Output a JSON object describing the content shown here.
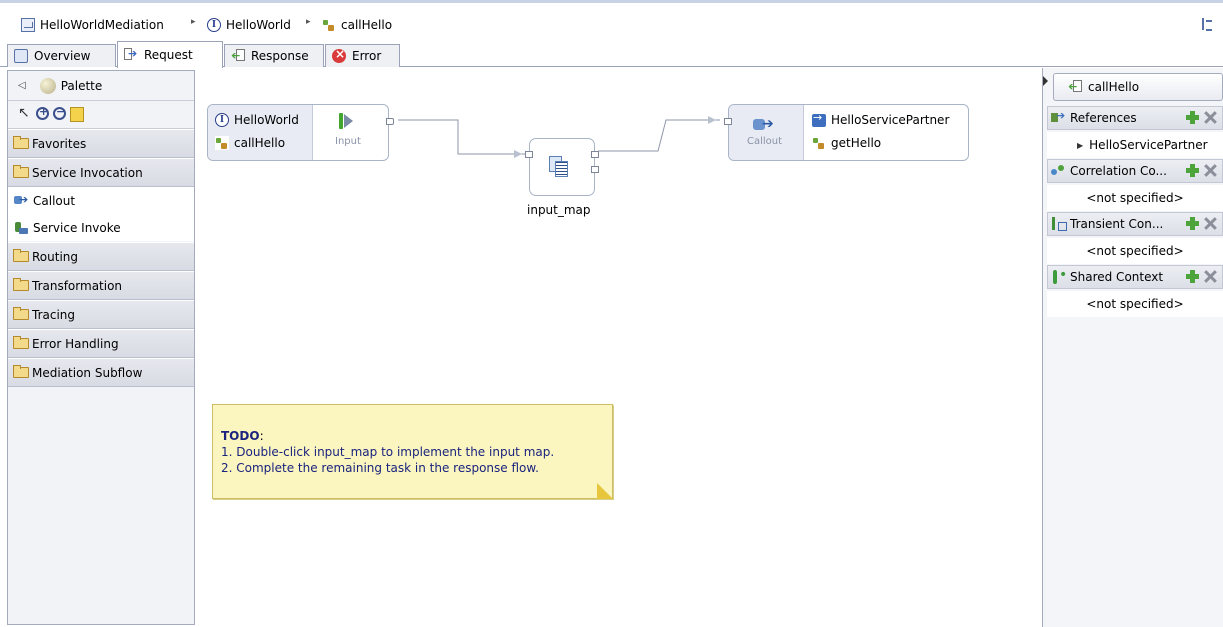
{
  "breadcrumb": {
    "items": [
      {
        "label": "HelloWorldMediation",
        "icon": "mediation-module-icon"
      },
      {
        "label": "HelloWorld",
        "icon": "interface-icon"
      },
      {
        "label": "callHello",
        "icon": "operation-icon"
      }
    ],
    "separator": "▸"
  },
  "tabs": [
    {
      "label": "Overview",
      "icon": "overview-icon",
      "active": false
    },
    {
      "label": "Request",
      "icon": "request-flow-icon",
      "active": true
    },
    {
      "label": "Response",
      "icon": "response-flow-icon",
      "active": false
    },
    {
      "label": "Error",
      "icon": "error-icon",
      "active": false
    }
  ],
  "palette": {
    "title": "Palette",
    "collapse_glyph": "◁",
    "tools": [
      "select-tool",
      "zoom-in-tool",
      "zoom-out-tool",
      "note-tool"
    ],
    "drawers": [
      {
        "label": "Favorites",
        "expanded": false
      },
      {
        "label": "Service Invocation",
        "expanded": true,
        "items": [
          "Callout",
          "Service Invoke"
        ]
      },
      {
        "label": "Routing",
        "expanded": false
      },
      {
        "label": "Transformation",
        "expanded": false
      },
      {
        "label": "Tracing",
        "expanded": false
      },
      {
        "label": "Error Handling",
        "expanded": false
      },
      {
        "label": "Mediation Subflow",
        "expanded": false
      }
    ]
  },
  "canvas": {
    "input_node": {
      "interface": "HelloWorld",
      "operation": "callHello",
      "terminal_label": "Input"
    },
    "map_node": {
      "label": "input_map"
    },
    "callout_node": {
      "terminal_label": "Callout",
      "partner": "HelloServicePartner",
      "operation": "getHello"
    },
    "note": {
      "title": "TODO",
      "colon": ":",
      "lines": [
        "1. Double-click input_map to implement the input map.",
        "2. Complete the remaining task in the response flow."
      ]
    }
  },
  "right_panel": {
    "operation": "callHello",
    "sections": [
      {
        "label": "References",
        "child": "HelloServicePartner",
        "icon": "references-icon"
      },
      {
        "label": "Correlation Co...",
        "child": "<not specified>",
        "icon": "correlation-context-icon"
      },
      {
        "label": "Transient Con...",
        "child": "<not specified>",
        "icon": "transient-context-icon"
      },
      {
        "label": "Shared Context",
        "child": "<not specified>",
        "icon": "shared-context-icon"
      }
    ]
  },
  "colors": {
    "accent": "#5670a8",
    "note_background": "#fbf5c0",
    "note_text": "#1a237e",
    "add_icon": "#4ca43a"
  }
}
